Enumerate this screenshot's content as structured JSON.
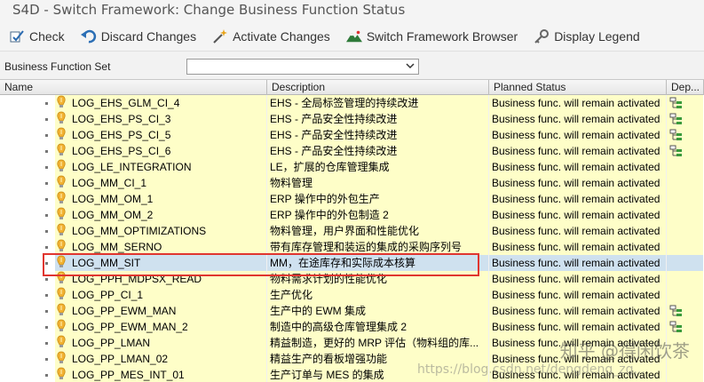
{
  "window": {
    "title": "S4D - Switch Framework: Change Business Function Status"
  },
  "toolbar": {
    "check": "Check",
    "discard": "Discard Changes",
    "activate": "Activate Changes",
    "browser": "Switch Framework Browser",
    "legend": "Display Legend"
  },
  "bfs": {
    "label": "Business Function Set",
    "value": ""
  },
  "columns": {
    "name": "Name",
    "description": "Description",
    "planned_status": "Planned Status",
    "dependencies": "Dep..."
  },
  "colors": {
    "row_yellow": "#fefec8",
    "selected": "#cfe1ef",
    "highlight_border": "#e0352f"
  },
  "rows": [
    {
      "name": "LOG_EHS_GLM_CI_4",
      "description": "EHS - 全局标签管理的持续改进",
      "status": "Business func. will remain activated",
      "dep_icon": true
    },
    {
      "name": "LOG_EHS_PS_CI_3",
      "description": "EHS - 产品安全性持续改进",
      "status": "Business func. will remain activated",
      "dep_icon": true
    },
    {
      "name": "LOG_EHS_PS_CI_5",
      "description": "EHS - 产品安全性持续改进",
      "status": "Business func. will remain activated",
      "dep_icon": true
    },
    {
      "name": "LOG_EHS_PS_CI_6",
      "description": "EHS - 产品安全性持续改进",
      "status": "Business func. will remain activated",
      "dep_icon": true
    },
    {
      "name": "LOG_LE_INTEGRATION",
      "description": "LE，扩展的仓库管理集成",
      "status": "Business func. will remain activated",
      "dep_icon": false
    },
    {
      "name": "LOG_MM_CI_1",
      "description": "物料管理",
      "status": "Business func. will remain activated",
      "dep_icon": false
    },
    {
      "name": "LOG_MM_OM_1",
      "description": "ERP 操作中的外包生产",
      "status": "Business func. will remain activated",
      "dep_icon": false
    },
    {
      "name": "LOG_MM_OM_2",
      "description": "ERP 操作中的外包制造 2",
      "status": "Business func. will remain activated",
      "dep_icon": false
    },
    {
      "name": "LOG_MM_OPTIMIZATIONS",
      "description": "物料管理，用户界面和性能优化",
      "status": "Business func. will remain activated",
      "dep_icon": false
    },
    {
      "name": "LOG_MM_SERNO",
      "description": "带有库存管理和装运的集成的采购序列号",
      "status": "Business func. will remain activated",
      "dep_icon": false
    },
    {
      "name": "LOG_MM_SIT",
      "description": "MM，在途库存和实际成本核算",
      "status": "Business func. will remain activated",
      "dep_icon": false,
      "selected": true
    },
    {
      "name": "LOG_PPH_MDPSX_READ",
      "description": "物料需求计划的性能优化",
      "status": "Business func. will remain activated",
      "dep_icon": false
    },
    {
      "name": "LOG_PP_CI_1",
      "description": "生产优化",
      "status": "Business func. will remain activated",
      "dep_icon": false
    },
    {
      "name": "LOG_PP_EWM_MAN",
      "description": "生产中的 EWM 集成",
      "status": "Business func. will remain activated",
      "dep_icon": true
    },
    {
      "name": "LOG_PP_EWM_MAN_2",
      "description": "制造中的高级仓库管理集成 2",
      "status": "Business func. will remain activated",
      "dep_icon": true
    },
    {
      "name": "LOG_PP_LMAN",
      "description": "精益制造，更好的 MRP 评估（物料组的库...",
      "status": "Business func. will remain activated",
      "dep_icon": false
    },
    {
      "name": "LOG_PP_LMAN_02",
      "description": "精益生产的看板增强功能",
      "status": "Business func. will remain activated",
      "dep_icon": false
    },
    {
      "name": "LOG_PP_MES_INT_01",
      "description": "生产订单与 MES 的集成",
      "status": "Business func. will remain activated",
      "dep_icon": false
    }
  ],
  "watermark": {
    "text": "知乎 @得闲饮茶",
    "url": "https://blog.csdn.net/dengdeng_zg..."
  }
}
